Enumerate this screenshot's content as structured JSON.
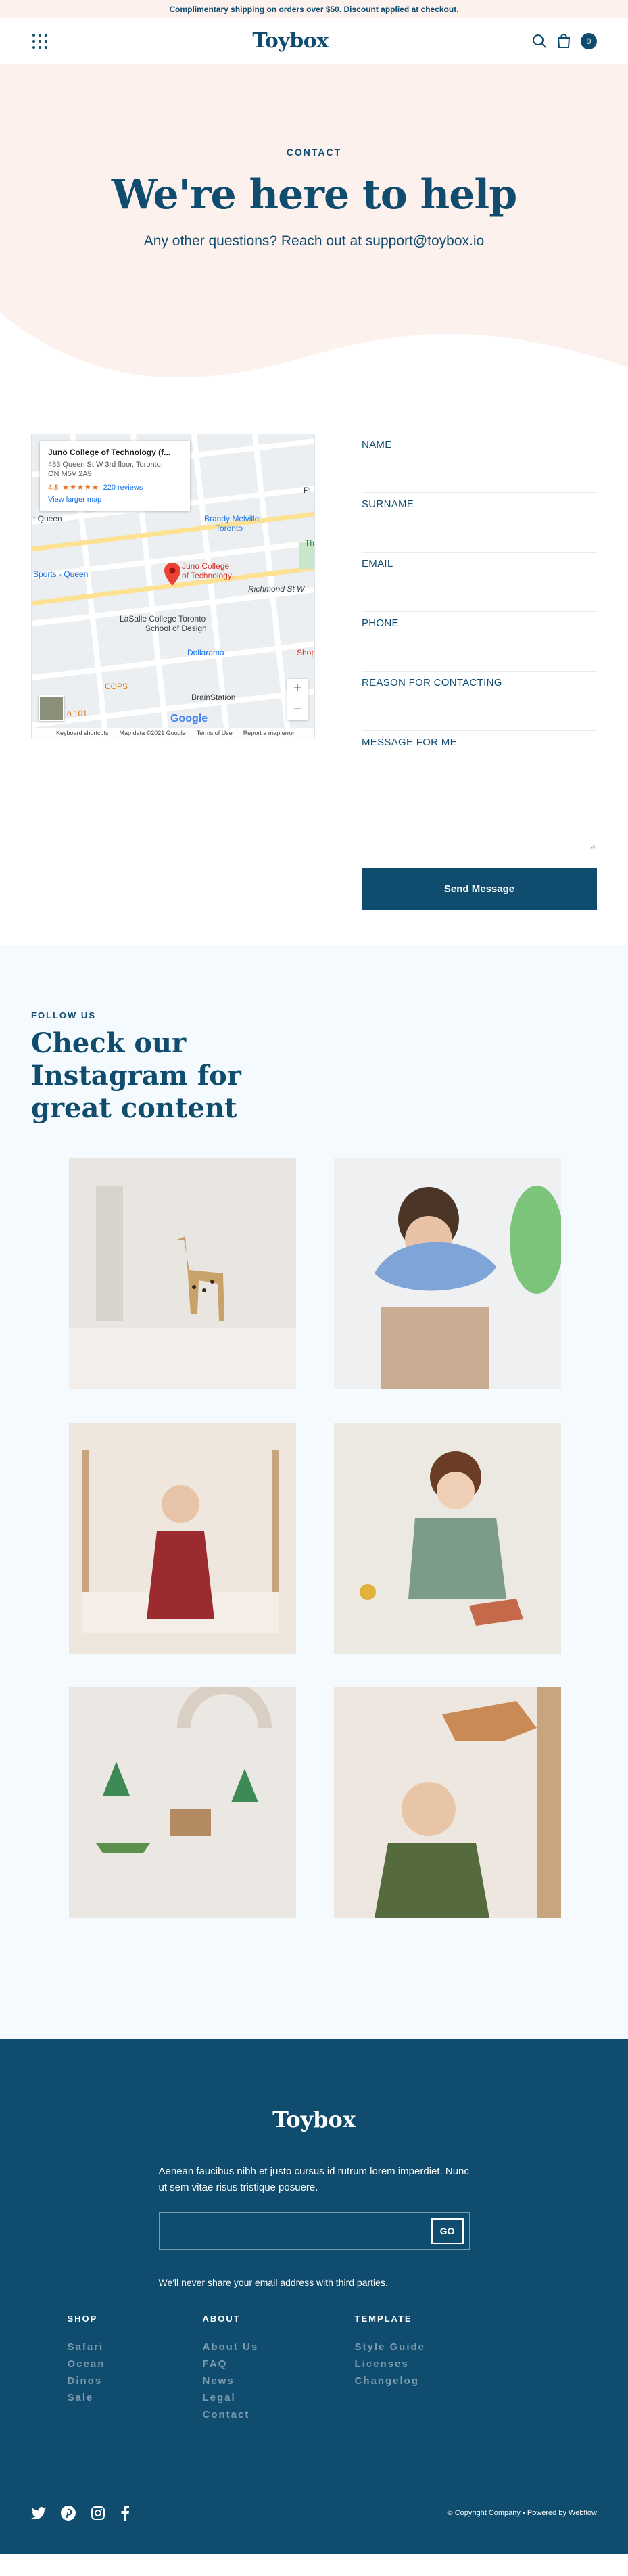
{
  "announcement": "Complimentary shipping on orders over $50. Discount applied at checkout.",
  "nav": {
    "logo": "Toybox",
    "cart_count": "0"
  },
  "hero": {
    "eyebrow": "CONTACT",
    "title": "We're here to help",
    "subtitle": "Any other questions? Reach out at support@toybox.io"
  },
  "map": {
    "place_name": "Juno College of Technology (f...",
    "address_line1": "483 Queen St W 3rd floor, Toronto,",
    "address_line2": "ON M5V 2A9",
    "rating": "4.8",
    "stars": "★★★★★",
    "reviews": "220 reviews",
    "larger_map": "View larger map",
    "labels": {
      "queen": "t Queen",
      "sports": "Sports - Queen",
      "brandy": "Brandy Melville",
      "toronto": "Toronto",
      "juno1": "Juno College",
      "juno2": "of Technology...",
      "richmond": "Richmond St W",
      "lasalle1": "LaSalle College Toronto",
      "lasalle2": "School of Design",
      "dollarama": "Dollarama",
      "shoppers": "Shoppers I",
      "cops": "COPS",
      "brainstation": "BrainStation",
      "cafe": "o 101",
      "th": "Th",
      "pl": "Pl"
    },
    "footer": [
      "Keyboard shortcuts",
      "Map data ©2021 Google",
      "Terms of Use",
      "Report a map error"
    ],
    "google": "Google",
    "zoom_in": "+",
    "zoom_out": "−"
  },
  "form": {
    "name": "NAME",
    "surname": "SURNAME",
    "email": "EMAIL",
    "phone": "PHONE",
    "reason": "REASON FOR CONTACTING",
    "message": "MESSAGE FOR ME",
    "submit": "Send Message"
  },
  "instagram": {
    "eyebrow": "FOLLOW US",
    "title": "Check our Instagram for great content"
  },
  "footer": {
    "logo": "Toybox",
    "description": "Aenean faucibus nibh et justo cursus id rutrum lorem imperdiet. Nunc ut sem vitae risus tristique posuere.",
    "go": "GO",
    "note": "We'll never share your email address with third parties.",
    "columns": [
      {
        "title": "SHOP",
        "links": [
          "Safari",
          "Ocean",
          "Dinos",
          "Sale"
        ]
      },
      {
        "title": "ABOUT",
        "links": [
          "About Us",
          "FAQ",
          "News",
          "Legal",
          "Contact"
        ]
      },
      {
        "title": "TEMPLATE",
        "links": [
          "Style Guide",
          "Licenses",
          "Changelog"
        ]
      }
    ],
    "copyright": "© Copyright Company • Powered by Webflow"
  },
  "icons": [
    "grid-menu-icon",
    "search-icon",
    "cart-icon",
    "twitter-icon",
    "pinterest-icon",
    "instagram-icon",
    "facebook-icon",
    "map-pin-icon"
  ],
  "colors": {
    "primary": "#0f4c6e",
    "hero_bg": "#fdf1ee",
    "insta_bg": "#f4fafd",
    "muted_link": "#7d9bb0"
  }
}
